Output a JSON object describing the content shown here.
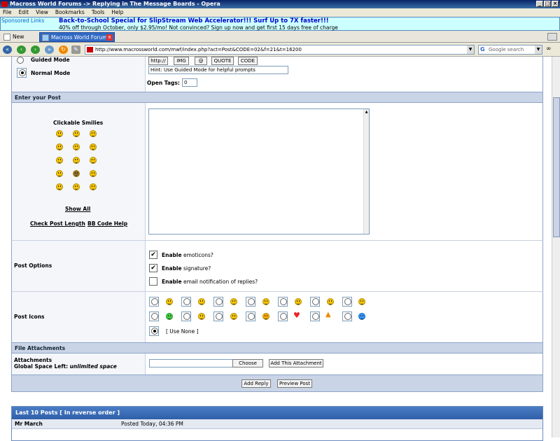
{
  "window": {
    "title": "Macross World Forums -> Replying in The Message Boards - Opera"
  },
  "menu": [
    "File",
    "Edit",
    "View",
    "Bookmarks",
    "Tools",
    "Help"
  ],
  "ad": {
    "sponsored": "Sponsored Links",
    "headline": "Back-to-School Special for SlipStream Web Accelerator!!! Surf Up to 7X faster!!!",
    "sub": "40% off through October, only $2.95/mo! Not convinced? Sign up now and get first 15 days free of charge"
  },
  "tabs": [
    {
      "label": "New page"
    },
    {
      "label": "Macross World Forums -..."
    }
  ],
  "nav": {
    "address": "http://www.macrossworld.com/mwf/index.php?act=Post&CODE=02&f=21&t=16200",
    "search_placeholder": "Google search"
  },
  "editor": {
    "guided_mode": "Guided Mode",
    "normal_mode": "Normal Mode",
    "tag_buttons": [
      "http://",
      "IMG",
      "@",
      "QUOTE",
      "CODE"
    ],
    "hint": "Hint: Use Guided Mode for helpful prompts",
    "open_tags_label": "Open Tags:",
    "open_tags_value": "0"
  },
  "enter_post": {
    "section_title": "Enter your Post",
    "smilies_title": "Clickable Smilies",
    "show_all": "Show All",
    "check_length": "Check Post Length",
    "sep": "·",
    "bbcode_help": "BB Code Help"
  },
  "post_options": {
    "label": "Post Options",
    "items": [
      {
        "bold": "Enable",
        "text": "emoticons?",
        "checked": true
      },
      {
        "bold": "Enable",
        "text": "signature?",
        "checked": true
      },
      {
        "bold": "Enable",
        "text": "email notification of replies?",
        "checked": false
      }
    ]
  },
  "post_icons": {
    "label": "Post Icons",
    "use_none": "[ Use None ]"
  },
  "attachments": {
    "section_title": "File Attachments",
    "label1": "Attachments",
    "label2_bold": "Global Space Left:",
    "label2_value": "unlimited space",
    "choose": "Choose",
    "add": "Add This Attachment"
  },
  "submit": {
    "add_reply": "Add Reply",
    "preview": "Preview Post"
  },
  "last_posts": {
    "title": "Last 10 Posts [ In reverse order ]",
    "author": "Mr March",
    "posted": "Posted Today, 04:36 PM"
  },
  "colors": {
    "accent": "#2f5fa8",
    "section_bg": "#c9d4e6"
  }
}
